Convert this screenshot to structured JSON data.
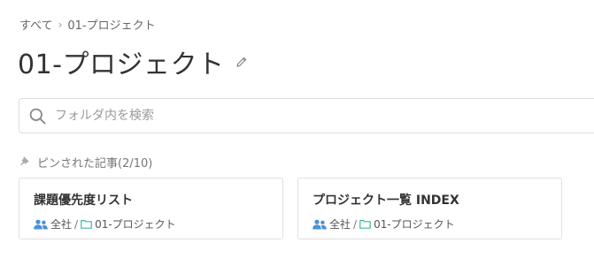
{
  "breadcrumb": {
    "root": "すべて",
    "separator": "›",
    "current": "01-プロジェクト"
  },
  "page": {
    "title": "01-プロジェクト"
  },
  "search": {
    "placeholder": "フォルダ内を検索",
    "value": ""
  },
  "pinned": {
    "header": "ピンされた記事(2/10)",
    "cards": [
      {
        "title": "課題優先度リスト",
        "group": "全社",
        "separator": "/",
        "folder": "01-プロジェクト"
      },
      {
        "title": "プロジェクト一覧 INDEX",
        "group": "全社",
        "separator": "/",
        "folder": "01-プロジェクト"
      }
    ]
  },
  "colors": {
    "group_icon": "#4a90d9",
    "folder_icon": "#3cb6a0",
    "muted": "#999999"
  },
  "icons": {
    "edit": "pencil-icon",
    "search": "search-icon",
    "pin": "pin-icon",
    "group": "users-icon",
    "folder": "folder-icon"
  }
}
